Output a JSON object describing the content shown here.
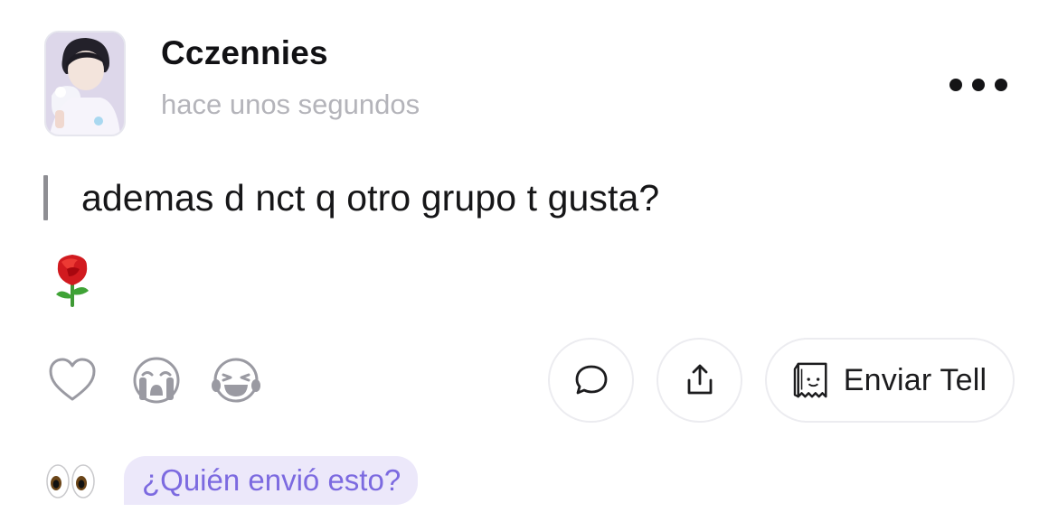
{
  "post": {
    "username": "Cczennies",
    "timestamp": "hace unos segundos",
    "question": "ademas d nct q otro grupo t gusta?",
    "emoji": "rose"
  },
  "reactions": [
    {
      "name": "heart-icon"
    },
    {
      "name": "crying-face-icon"
    },
    {
      "name": "laughing-face-icon"
    }
  ],
  "actions": {
    "comment_icon": "chat-bubble-icon",
    "share_icon": "share-icon",
    "send_label": "Enviar Tell",
    "send_icon": "bag-face-icon"
  },
  "footer": {
    "eyes_emoji": "eyes",
    "who_sent": "¿Quién envió esto?"
  },
  "colors": {
    "accent_purple": "#7c6ae0",
    "bubble_bg": "#ece8fa",
    "muted_gray": "#b4b4ba"
  }
}
